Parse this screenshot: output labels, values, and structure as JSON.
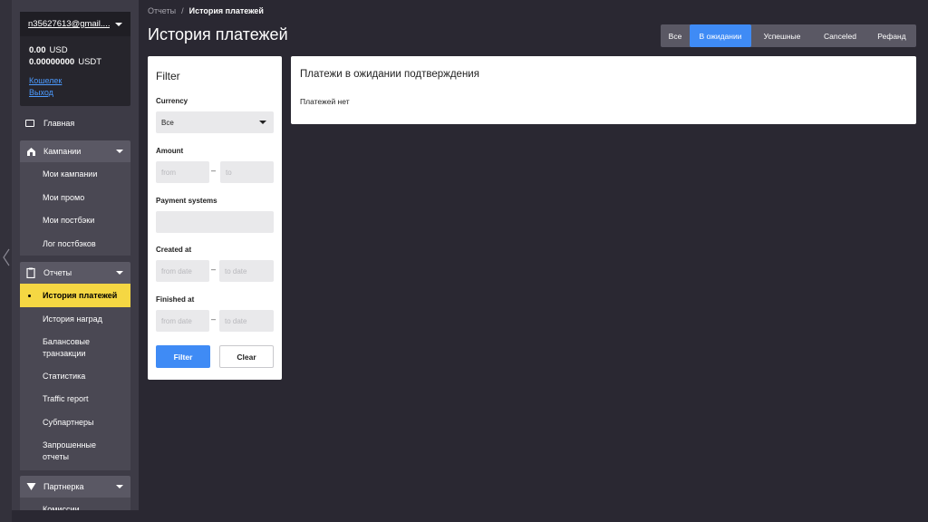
{
  "account": {
    "email": "n35627613@gmail....",
    "balances": [
      {
        "amount": "0.00",
        "currency": "USD"
      },
      {
        "amount": "0.00000000",
        "currency": "USDT"
      }
    ],
    "wallet_link": "Кошелек",
    "logout_link": "Выход"
  },
  "nav": {
    "home": "Главная",
    "campaigns": {
      "label": "Кампании",
      "items": [
        "Мои кампании",
        "Мои промо",
        "Мои постбэки",
        "Лог постбэков"
      ]
    },
    "reports": {
      "label": "Отчеты",
      "items": [
        "История платежей",
        "История наград",
        "Балансовые транзакции",
        "Статистика",
        "Traffic report",
        "Субпартнеры",
        "Запрошенные отчеты"
      ]
    },
    "partner": {
      "label": "Партнерка",
      "items": [
        "Комиссии"
      ]
    }
  },
  "breadcrumb": {
    "parent": "Отчеты",
    "separator": "/",
    "current": "История платежей"
  },
  "page_title": "История платежей",
  "tabs": [
    "Все",
    "В ожидании",
    "Успешные",
    "Canceled",
    "Рефанд"
  ],
  "active_tab": "В ожидании",
  "filter": {
    "title": "Filter",
    "currency_label": "Currency",
    "currency_value": "Все",
    "amount_label": "Amount",
    "amount_from_placeholder": "from",
    "amount_to_placeholder": "to",
    "payment_systems_label": "Payment systems",
    "created_label": "Created at",
    "created_from_placeholder": "from date",
    "created_to_placeholder": "to date",
    "finished_label": "Finished at",
    "finished_from_placeholder": "from date",
    "finished_to_placeholder": "to date",
    "dash": "–",
    "filter_button": "Filter",
    "clear_button": "Clear"
  },
  "results": {
    "title": "Платежи в ожидании подтверждения",
    "empty_text": "Платежей нет"
  },
  "colors": {
    "accent": "#3f8bf5",
    "active_nav": "#f5d743",
    "background": "#2a2832"
  }
}
